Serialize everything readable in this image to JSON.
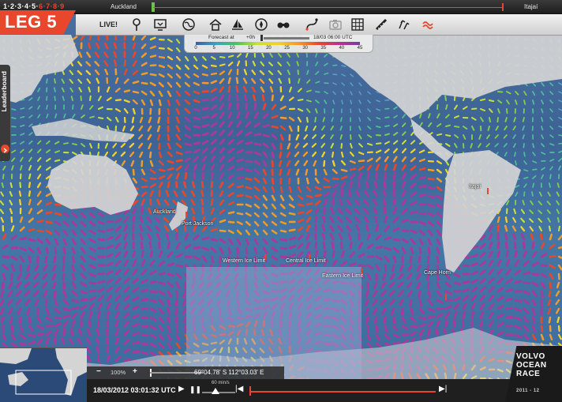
{
  "topbar": {
    "leg_steps": [
      {
        "n": "1",
        "done": true
      },
      {
        "n": "2",
        "done": true
      },
      {
        "n": "3",
        "done": true
      },
      {
        "n": "4",
        "done": true
      },
      {
        "n": "5",
        "done": true
      },
      {
        "n": "6",
        "done": false
      },
      {
        "n": "7",
        "done": false
      },
      {
        "n": "8",
        "done": false
      },
      {
        "n": "9",
        "done": false
      }
    ],
    "start_city": "Auckland",
    "end_city": "Itajaí"
  },
  "leg_badge": "LEG 5",
  "toolbar": {
    "live_label": "LIVE!",
    "tools": [
      {
        "name": "pin-icon"
      },
      {
        "name": "screen-icon"
      },
      {
        "name": "globe-icon"
      },
      {
        "name": "home-icon"
      },
      {
        "name": "sailboat-icon"
      },
      {
        "name": "compass-icon"
      },
      {
        "name": "binoculars-icon"
      },
      {
        "name": "route-icon"
      },
      {
        "name": "camera-icon"
      },
      {
        "name": "grid-icon"
      },
      {
        "name": "ruler-icon"
      },
      {
        "name": "wind-icon"
      },
      {
        "name": "waves-icon"
      }
    ]
  },
  "forecast": {
    "label": "Forecast at",
    "offset": "+0h",
    "time": "18/03 06:00 UTC",
    "scale_ticks": [
      "0",
      "5",
      "10",
      "15",
      "20",
      "25",
      "30",
      "35",
      "40",
      "45"
    ]
  },
  "leaderboard_label": "Leaderboard",
  "map_labels": {
    "auckland": "Auckland",
    "port_jackson": "Port Jackson",
    "itajai": "Itajaí",
    "western_ice": "Western Ice Limit",
    "central_ice": "Central Ice Limit",
    "eastern_ice": "Eastern Ice Limit",
    "cape_horn": "Cape Horn"
  },
  "status": {
    "zoom_out": "−",
    "zoom_level": "100%",
    "zoom_in": "+",
    "coords": "69°04.78' S 112°03.03' E"
  },
  "bottom": {
    "datetime": "18/03/2012 03:01:32 UTC",
    "speed": "60 min/s"
  },
  "logo": {
    "line1": "VOLVO",
    "line2": "OCEAN",
    "line3": "RACE",
    "years": "2011 - 12"
  },
  "colors": {
    "accent": "#e8472c",
    "ocean": "#3d6395",
    "land": "#cfcfcf"
  }
}
